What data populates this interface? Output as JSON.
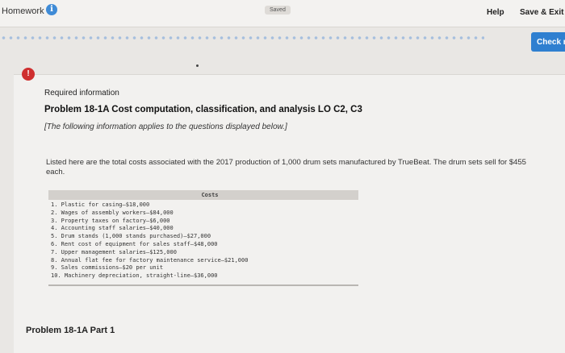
{
  "topbar": {
    "title": "Homework",
    "info_glyph": "i",
    "saved": "Saved",
    "help": "Help",
    "save_exit": "Save & Exit",
    "check": "Check r"
  },
  "alert_glyph": "!",
  "question": {
    "required_info": "Required information",
    "problem_title": "Problem 18-1A Cost computation, classification, and analysis LO C2, C3",
    "applies_note": "[The following information applies to the questions displayed below.]",
    "intro": "Listed here are the total costs associated with the 2017 production of 1,000 drum sets manufactured by TrueBeat. The drum sets sell for $455 each."
  },
  "costs_table": {
    "header": "Costs",
    "items": [
      "1. Plastic for casing—$18,000",
      "2. Wages of assembly workers—$84,000",
      "3. Property taxes on factory—$6,000",
      "4. Accounting staff salaries—$40,000",
      "5. Drum stands (1,000 stands purchased)—$27,000",
      "6. Rent cost of equipment for sales staff—$48,000",
      "7. Upper management salaries—$125,000",
      "8. Annual flat fee for factory maintenance service—$21,000",
      "9. Sales commissions—$20 per unit",
      "10. Machinery depreciation, straight-line—$36,000"
    ]
  },
  "part_title": "Problem 18-1A Part 1",
  "colors": {
    "accent_blue": "#2f7fd0",
    "alert_red": "#cf2f2f",
    "progress_dots": "#8fb2dc"
  },
  "icons": {
    "info": "info-icon",
    "alert": "alert-icon"
  }
}
